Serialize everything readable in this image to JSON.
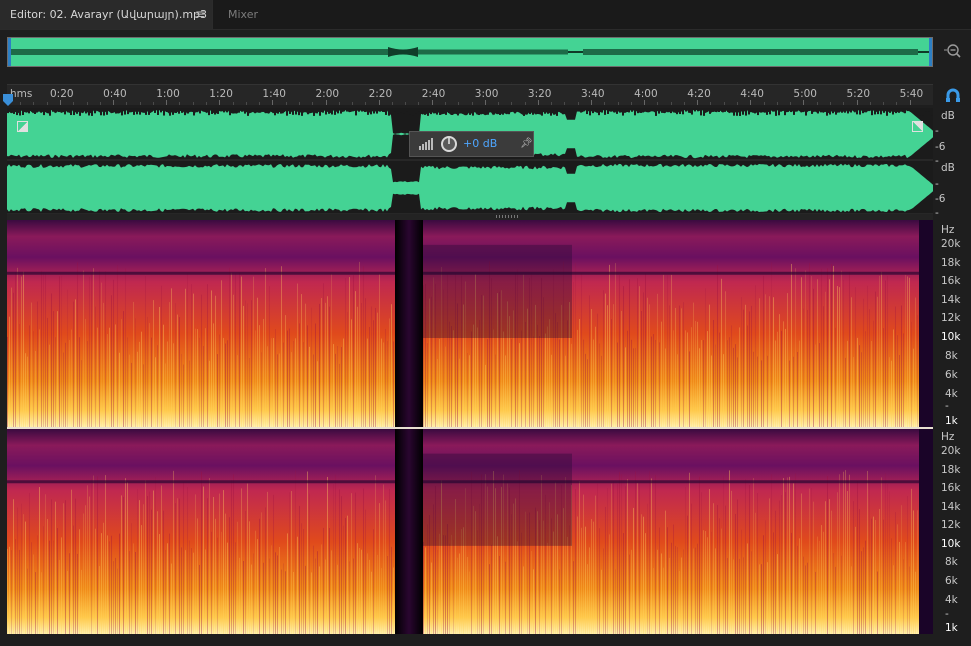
{
  "tabs": {
    "editor_label": "Editor: 02. Avarayr (Ավարայր).mp3",
    "mixer_label": "Mixer",
    "menu_icon": "hamburger-icon"
  },
  "ruler": {
    "unit_label": "hms",
    "ticks": [
      "0:20",
      "0:40",
      "1:00",
      "1:20",
      "1:40",
      "2:00",
      "2:20",
      "2:40",
      "3:00",
      "3:20",
      "3:40",
      "4:00",
      "4:20",
      "4:40",
      "5:00",
      "5:20",
      "5:40"
    ]
  },
  "hud": {
    "value": "+0 dB",
    "icons": [
      "level-meter-icon",
      "volume-knob-icon",
      "pin-icon"
    ]
  },
  "amplitude_scale": {
    "channel_1": [
      "dB",
      "-",
      "-6",
      "-"
    ],
    "channel_2": [
      "dB",
      "-",
      "-6",
      "-"
    ]
  },
  "spectral_scale": {
    "channel_1": [
      "Hz",
      "20k",
      "18k",
      "16k",
      "14k",
      "12k",
      "10k",
      "8k",
      "6k",
      "4k",
      "-",
      "1k"
    ],
    "channel_2": [
      "Hz",
      "20k",
      "18k",
      "16k",
      "14k",
      "12k",
      "10k",
      "8k",
      "6k",
      "4k",
      "-",
      "1k"
    ]
  },
  "colors": {
    "waveform": "#44d394",
    "background": "#1e1e1e",
    "accent": "#4ea6ff",
    "playhead": "#3a8fd9"
  },
  "icons": {
    "zoom": "zoom-out-icon",
    "snap": "snap-to-playhead-icon",
    "fade_in": "fade-in-handle-icon",
    "fade_out": "fade-out-handle-icon"
  }
}
